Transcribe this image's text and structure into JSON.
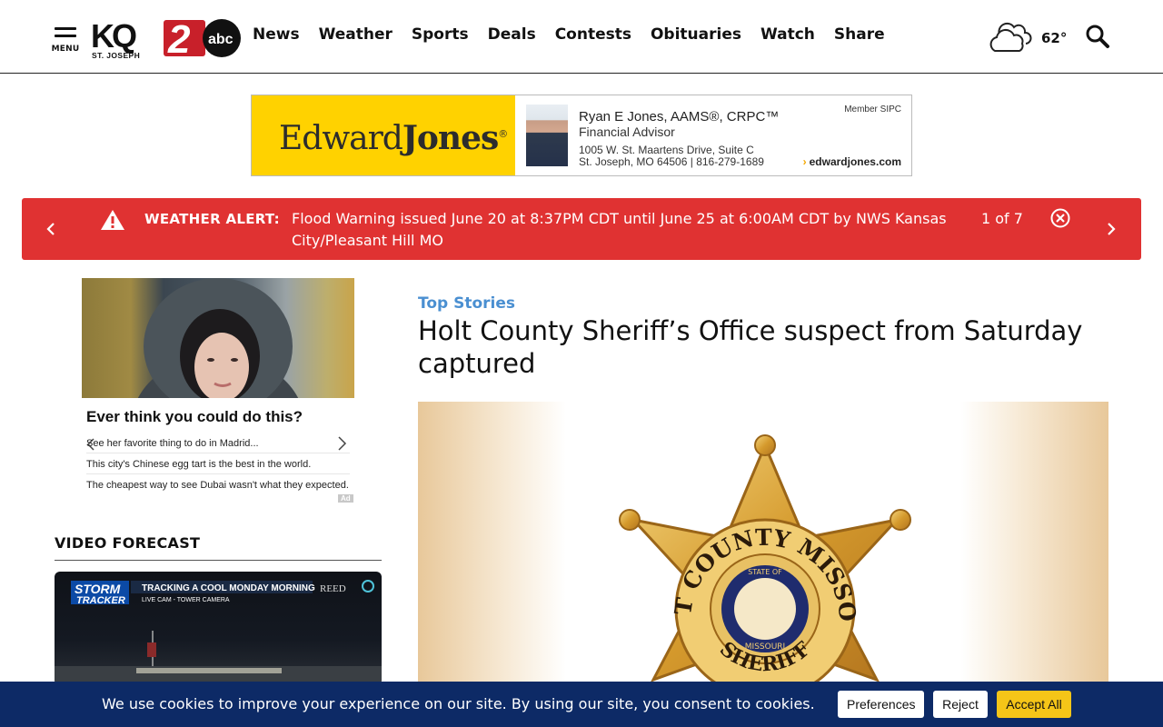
{
  "header": {
    "menu_label": "MENU",
    "logo": {
      "call_sign": "KQ",
      "number": "2",
      "network": "abc",
      "city": "ST. JOSEPH"
    },
    "nav": [
      "News",
      "Weather",
      "Sports",
      "Deals",
      "Contests",
      "Obituaries",
      "Watch",
      "Share"
    ],
    "weather": {
      "icon": "cloud-icon",
      "temperature": "62°"
    },
    "search_icon": "search-icon"
  },
  "ad_banner": {
    "brand_light": "Edward",
    "brand_bold": "Jones",
    "brand_mark": "®",
    "name": "Ryan E Jones, AAMS®, CRPC™",
    "title": "Financial Advisor",
    "address_line1": "1005 W. St. Maartens Drive, Suite C",
    "address_line2": "St. Joseph, MO 64506  |  816-279-1689",
    "member": "Member SIPC",
    "url": "edwardjones.com",
    "colors": {
      "yellow": "#ffd200"
    }
  },
  "alert": {
    "label": "WEATHER ALERT:",
    "message": "Flood Warning issued June 20 at 8:37PM CDT until June 25 at 6:00AM CDT by NWS Kansas City/Pleasant Hill MO",
    "counter": "1 of 7",
    "color": "#e03232"
  },
  "side_ad": {
    "headline": "Ever think you could do this?",
    "lines": [
      "See her favorite thing to do in Madrid...",
      "This city's Chinese egg tart is the best in the world.",
      "The cheapest way to see Dubai wasn't what they expected."
    ],
    "ad_tag": "Ad"
  },
  "video_forecast": {
    "heading": "VIDEO FORECAST",
    "brand_top": "STORM",
    "brand_bottom": "TRACKER",
    "banner": "TRACKING A COOL MONDAY MORNING",
    "sub_banner": "LIVE CAM - TOWER CAMERA",
    "sponsor": "REED"
  },
  "story": {
    "kicker": "Top Stories",
    "title": "Holt County Sheriff’s Office suspect from Saturday captured",
    "badge_arc_top": "HOLT COUNTY MISSOURI",
    "badge_arc_bottom": "SHERIFF",
    "seal_top": "STATE OF",
    "seal_bottom": "MISSOURI"
  },
  "cookie_bar": {
    "text": "We use cookies to improve your experience on our site. By using our site, you consent to cookies.",
    "preferences": "Preferences",
    "reject": "Reject",
    "accept": "Accept All",
    "accent": "#f5c518",
    "background": "#0d2a66"
  }
}
